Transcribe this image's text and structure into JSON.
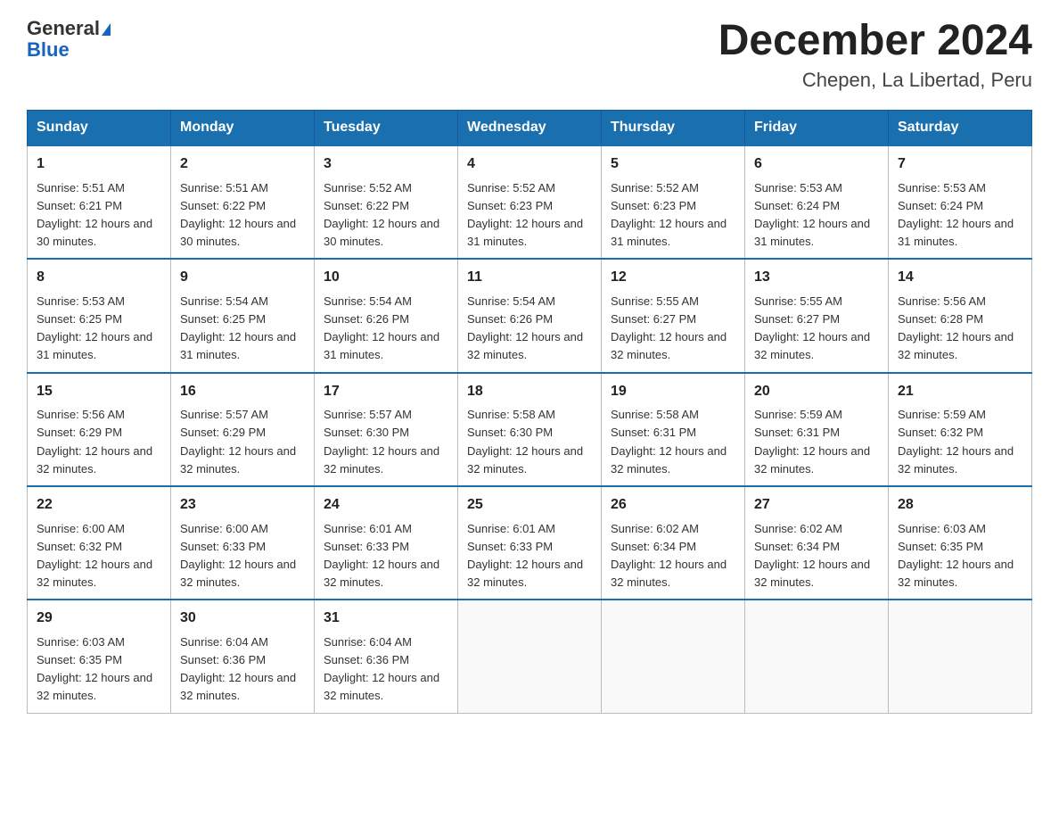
{
  "logo": {
    "line1": "General",
    "line2": "Blue"
  },
  "title": "December 2024",
  "subtitle": "Chepen, La Libertad, Peru",
  "days_of_week": [
    "Sunday",
    "Monday",
    "Tuesday",
    "Wednesday",
    "Thursday",
    "Friday",
    "Saturday"
  ],
  "weeks": [
    [
      {
        "day": 1,
        "sunrise": "5:51 AM",
        "sunset": "6:21 PM",
        "daylight": "12 hours and 30 minutes."
      },
      {
        "day": 2,
        "sunrise": "5:51 AM",
        "sunset": "6:22 PM",
        "daylight": "12 hours and 30 minutes."
      },
      {
        "day": 3,
        "sunrise": "5:52 AM",
        "sunset": "6:22 PM",
        "daylight": "12 hours and 30 minutes."
      },
      {
        "day": 4,
        "sunrise": "5:52 AM",
        "sunset": "6:23 PM",
        "daylight": "12 hours and 31 minutes."
      },
      {
        "day": 5,
        "sunrise": "5:52 AM",
        "sunset": "6:23 PM",
        "daylight": "12 hours and 31 minutes."
      },
      {
        "day": 6,
        "sunrise": "5:53 AM",
        "sunset": "6:24 PM",
        "daylight": "12 hours and 31 minutes."
      },
      {
        "day": 7,
        "sunrise": "5:53 AM",
        "sunset": "6:24 PM",
        "daylight": "12 hours and 31 minutes."
      }
    ],
    [
      {
        "day": 8,
        "sunrise": "5:53 AM",
        "sunset": "6:25 PM",
        "daylight": "12 hours and 31 minutes."
      },
      {
        "day": 9,
        "sunrise": "5:54 AM",
        "sunset": "6:25 PM",
        "daylight": "12 hours and 31 minutes."
      },
      {
        "day": 10,
        "sunrise": "5:54 AM",
        "sunset": "6:26 PM",
        "daylight": "12 hours and 31 minutes."
      },
      {
        "day": 11,
        "sunrise": "5:54 AM",
        "sunset": "6:26 PM",
        "daylight": "12 hours and 32 minutes."
      },
      {
        "day": 12,
        "sunrise": "5:55 AM",
        "sunset": "6:27 PM",
        "daylight": "12 hours and 32 minutes."
      },
      {
        "day": 13,
        "sunrise": "5:55 AM",
        "sunset": "6:27 PM",
        "daylight": "12 hours and 32 minutes."
      },
      {
        "day": 14,
        "sunrise": "5:56 AM",
        "sunset": "6:28 PM",
        "daylight": "12 hours and 32 minutes."
      }
    ],
    [
      {
        "day": 15,
        "sunrise": "5:56 AM",
        "sunset": "6:29 PM",
        "daylight": "12 hours and 32 minutes."
      },
      {
        "day": 16,
        "sunrise": "5:57 AM",
        "sunset": "6:29 PM",
        "daylight": "12 hours and 32 minutes."
      },
      {
        "day": 17,
        "sunrise": "5:57 AM",
        "sunset": "6:30 PM",
        "daylight": "12 hours and 32 minutes."
      },
      {
        "day": 18,
        "sunrise": "5:58 AM",
        "sunset": "6:30 PM",
        "daylight": "12 hours and 32 minutes."
      },
      {
        "day": 19,
        "sunrise": "5:58 AM",
        "sunset": "6:31 PM",
        "daylight": "12 hours and 32 minutes."
      },
      {
        "day": 20,
        "sunrise": "5:59 AM",
        "sunset": "6:31 PM",
        "daylight": "12 hours and 32 minutes."
      },
      {
        "day": 21,
        "sunrise": "5:59 AM",
        "sunset": "6:32 PM",
        "daylight": "12 hours and 32 minutes."
      }
    ],
    [
      {
        "day": 22,
        "sunrise": "6:00 AM",
        "sunset": "6:32 PM",
        "daylight": "12 hours and 32 minutes."
      },
      {
        "day": 23,
        "sunrise": "6:00 AM",
        "sunset": "6:33 PM",
        "daylight": "12 hours and 32 minutes."
      },
      {
        "day": 24,
        "sunrise": "6:01 AM",
        "sunset": "6:33 PM",
        "daylight": "12 hours and 32 minutes."
      },
      {
        "day": 25,
        "sunrise": "6:01 AM",
        "sunset": "6:33 PM",
        "daylight": "12 hours and 32 minutes."
      },
      {
        "day": 26,
        "sunrise": "6:02 AM",
        "sunset": "6:34 PM",
        "daylight": "12 hours and 32 minutes."
      },
      {
        "day": 27,
        "sunrise": "6:02 AM",
        "sunset": "6:34 PM",
        "daylight": "12 hours and 32 minutes."
      },
      {
        "day": 28,
        "sunrise": "6:03 AM",
        "sunset": "6:35 PM",
        "daylight": "12 hours and 32 minutes."
      }
    ],
    [
      {
        "day": 29,
        "sunrise": "6:03 AM",
        "sunset": "6:35 PM",
        "daylight": "12 hours and 32 minutes."
      },
      {
        "day": 30,
        "sunrise": "6:04 AM",
        "sunset": "6:36 PM",
        "daylight": "12 hours and 32 minutes."
      },
      {
        "day": 31,
        "sunrise": "6:04 AM",
        "sunset": "6:36 PM",
        "daylight": "12 hours and 32 minutes."
      },
      null,
      null,
      null,
      null
    ]
  ],
  "labels": {
    "sunrise": "Sunrise:",
    "sunset": "Sunset:",
    "daylight": "Daylight:"
  }
}
